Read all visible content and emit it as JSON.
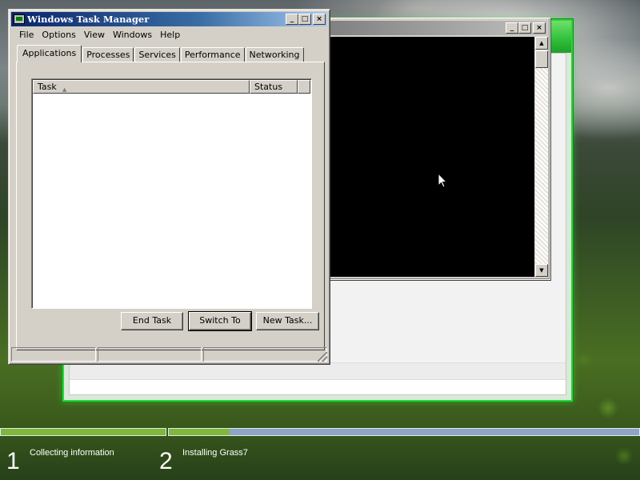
{
  "task_manager": {
    "title": "Windows Task Manager",
    "caption_buttons": {
      "minimize": "_",
      "maximize": "□",
      "close": "×"
    },
    "menu": [
      "File",
      "Options",
      "View",
      "Windows",
      "Help"
    ],
    "tabs": [
      "Applications",
      "Processes",
      "Services",
      "Performance",
      "Networking"
    ],
    "active_tab": "Applications",
    "list_columns": {
      "task": "Task",
      "status": "Status"
    },
    "buttons": {
      "end_task": "End Task",
      "switch_to": "Switch To",
      "new_task": "New Task..."
    }
  },
  "console": {
    "caption_buttons": {
      "minimize": "_",
      "maximize": "□",
      "close": "×"
    },
    "scroll_up": "▲",
    "scroll_down": "▼"
  },
  "setup": {
    "steps": [
      {
        "number": "1",
        "label": "Collecting information"
      },
      {
        "number": "2",
        "label": "Installing Grass7"
      }
    ],
    "progress": {
      "step1_fraction": 1.0,
      "step2_fraction": 0.13
    },
    "colors": {
      "progress_fill": "#7fb83a",
      "progress_rest": "#8ea6c4",
      "window_border": "#2bd63a"
    }
  }
}
